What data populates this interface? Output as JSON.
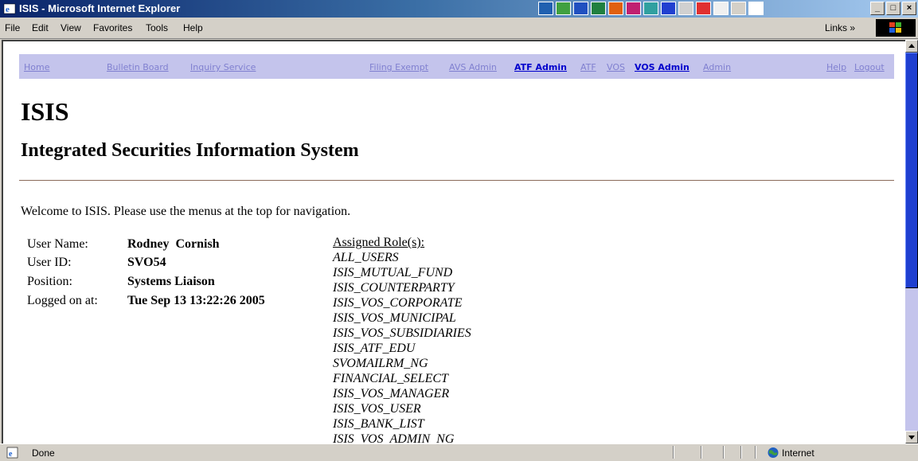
{
  "window": {
    "title": "ISIS - Microsoft Internet Explorer",
    "controls": [
      "_",
      "□",
      "×"
    ]
  },
  "menubar": {
    "items": [
      "File",
      "Edit",
      "View",
      "Favorites",
      "Tools",
      "Help"
    ],
    "links_label": "Links »"
  },
  "nav": {
    "items": [
      {
        "label": "Home",
        "active": false
      },
      {
        "label": "Bulletin Board",
        "active": false
      },
      {
        "label": "Inquiry Service",
        "active": false
      },
      {
        "label": "Filing Exempt",
        "active": false
      },
      {
        "label": "AVS Admin",
        "active": false
      },
      {
        "label": "ATF Admin",
        "active": true
      },
      {
        "label": "ATF",
        "active": false
      },
      {
        "label": "VOS",
        "active": false
      },
      {
        "label": "VOS Admin",
        "active": true
      },
      {
        "label": "Admin",
        "active": false
      },
      {
        "label": "Help",
        "active": false
      },
      {
        "label": "Logout",
        "active": false
      }
    ]
  },
  "page": {
    "title": "ISIS",
    "subtitle": "Integrated Securities Information System",
    "welcome": "Welcome to ISIS. Please use the menus at the top for navigation."
  },
  "user": {
    "name_label": "User Name:",
    "name": "Rodney  Cornish",
    "id_label": "User ID:",
    "id": "SVO54",
    "position_label": "Position:",
    "position": "Systems Liaison",
    "logged_label": "Logged on at:",
    "logged_on": "Tue Sep 13 13:22:26 2005"
  },
  "roles": {
    "heading": "Assigned Role(s):",
    "items": [
      "ALL_USERS",
      "ISIS_MUTUAL_FUND",
      "ISIS_COUNTERPARTY",
      "ISIS_VOS_CORPORATE",
      "ISIS_VOS_MUNICIPAL",
      "ISIS_VOS_SUBSIDIARIES",
      "ISIS_ATF_EDU",
      "SVOMAILRM_NG",
      "FINANCIAL_SELECT",
      "ISIS_VOS_MANAGER",
      "ISIS_VOS_USER",
      "ISIS_BANK_LIST",
      "ISIS_VOS_ADMIN_NG"
    ]
  },
  "status": {
    "text": "Done",
    "zone": "Internet"
  },
  "colors": {
    "nav_bg": "#c4c4ec",
    "nav_link": "#8080d0",
    "nav_active": "#0000cc",
    "titlebar": "#0a246a",
    "scroll_thumb": "#1f3fd0"
  },
  "tray_icons": [
    "msn-icon",
    "messenger-icon",
    "word-icon",
    "excel-icon",
    "outlook-icon",
    "powerpoint-icon",
    "publisher-icon",
    "explorer-icon",
    "search-icon",
    "desktop-icon",
    "acrobat-icon",
    "window-icon",
    "find-icon"
  ]
}
